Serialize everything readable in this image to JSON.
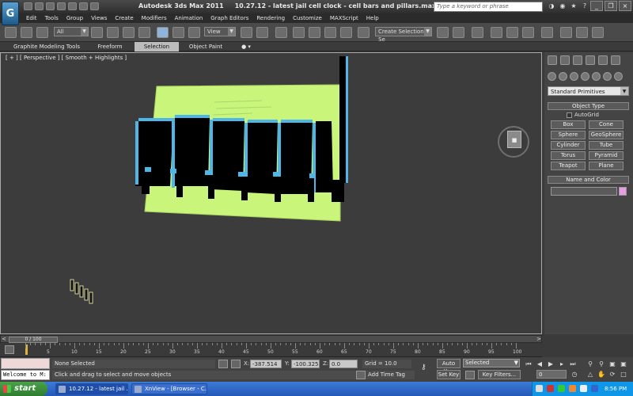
{
  "title_bar": {
    "app_name": "Autodesk 3ds Max  2011",
    "document_title": "10.27.12 - latest jail cell clock - cell bars and pillars.max",
    "search_placeholder": "Type a keyword or phrase"
  },
  "menu": [
    "Edit",
    "Tools",
    "Group",
    "Views",
    "Create",
    "Modifiers",
    "Animation",
    "Graph Editors",
    "Rendering",
    "Customize",
    "MAXScript",
    "Help"
  ],
  "toolbar": {
    "selection_filter": "All",
    "reference_coord": "View",
    "named_selection": "Create Selection Se"
  },
  "ribbon_tabs": [
    "Graphite Modeling Tools",
    "Freeform",
    "Selection",
    "Object Paint"
  ],
  "ribbon_active": "Selection",
  "viewport": {
    "label": "[ + ] [ Perspective ] [ Smooth + Highlights ]"
  },
  "command_panel": {
    "category": "Standard Primitives",
    "object_type_header": "Object Type",
    "autogrid": "AutoGrid",
    "buttons": [
      "Box",
      "Cone",
      "Sphere",
      "GeoSphere",
      "Cylinder",
      "Tube",
      "Torus",
      "Pyramid",
      "Teapot",
      "Plane"
    ],
    "name_color_header": "Name and Color",
    "swatch_color": "#e79ce3"
  },
  "time_slider": {
    "frame_display": "0 / 100",
    "ticks": [
      "5",
      "10",
      "15",
      "20",
      "25",
      "30",
      "35",
      "40",
      "45",
      "50",
      "55",
      "60",
      "65",
      "70",
      "75",
      "80",
      "85",
      "90",
      "95",
      "100"
    ]
  },
  "status_bar": {
    "listener_text": "Welcome to M:",
    "selection_status": "None Selected",
    "prompt": "Click and drag to select and move objects",
    "x_label": "X:",
    "x_value": "-387.514",
    "y_label": "Y:",
    "y_value": "-100.325",
    "z_label": "Z:",
    "z_value": "0.0",
    "grid": "Grid = 10.0",
    "add_time_tag": "Add Time Tag",
    "auto_key": "Auto Key",
    "set_key": "Set Key",
    "key_mode_select": "Selected",
    "key_filters": "Key Filters...",
    "current_frame": "0"
  },
  "taskbar": {
    "start": "start",
    "tasks": [
      "10.27.12 - latest jail ...",
      "XnView - [Browser - C..."
    ],
    "clock": "8:56 PM"
  }
}
